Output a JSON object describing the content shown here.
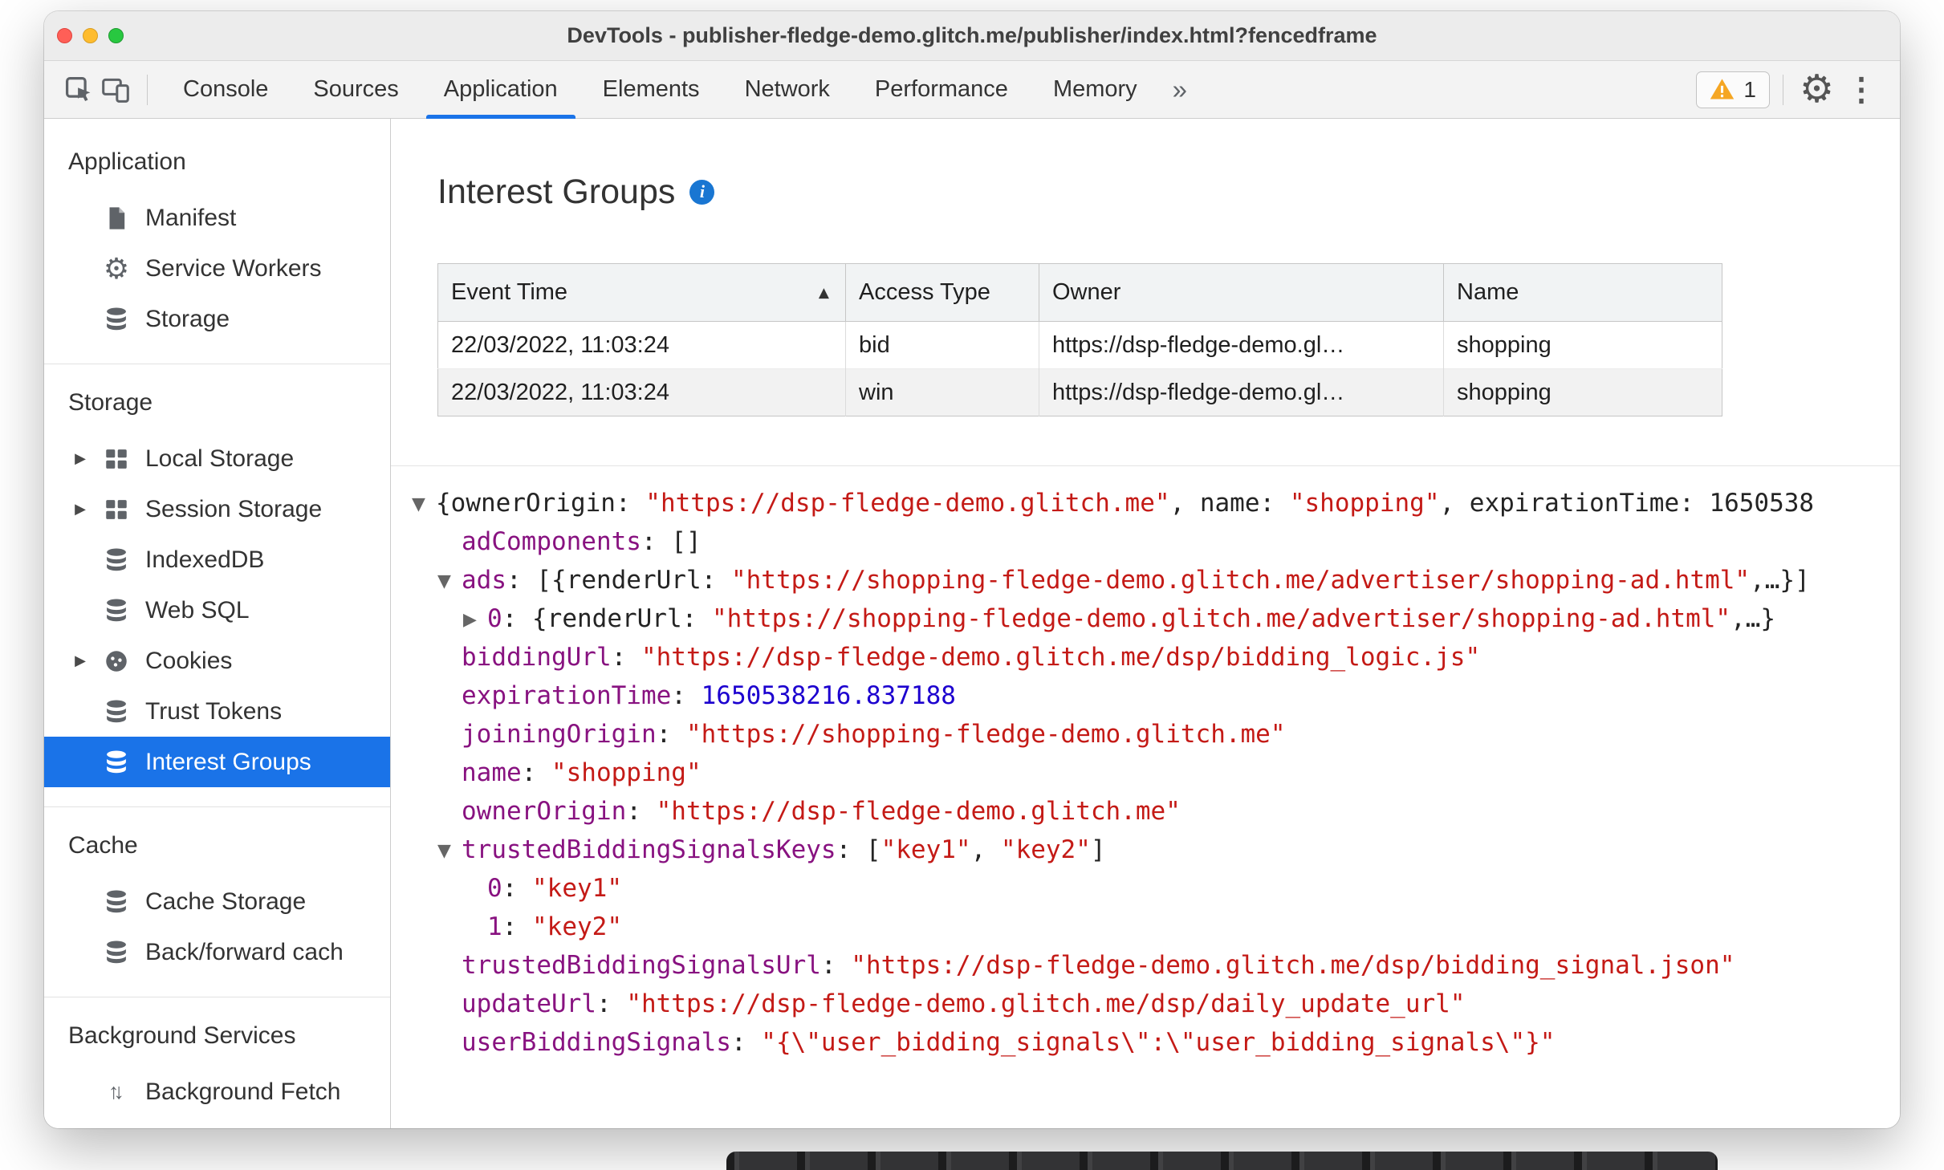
{
  "window": {
    "title": "DevTools - publisher-fledge-demo.glitch.me/publisher/index.html?fencedframe"
  },
  "toolbar": {
    "tabs": [
      {
        "label": "Console"
      },
      {
        "label": "Sources"
      },
      {
        "label": "Application",
        "selected": true
      },
      {
        "label": "Elements"
      },
      {
        "label": "Network"
      },
      {
        "label": "Performance"
      },
      {
        "label": "Memory"
      }
    ],
    "more_tabs": "»",
    "warning_count": "1"
  },
  "sidebar": {
    "sections": [
      {
        "title": "Application",
        "items": [
          {
            "label": "Manifest",
            "icon": "manifest-icon"
          },
          {
            "label": "Service Workers",
            "icon": "gear-icon"
          },
          {
            "label": "Storage",
            "icon": "database-icon"
          }
        ]
      },
      {
        "title": "Storage",
        "items": [
          {
            "label": "Local Storage",
            "icon": "table-icon",
            "expander": true
          },
          {
            "label": "Session Storage",
            "icon": "table-icon",
            "expander": true
          },
          {
            "label": "IndexedDB",
            "icon": "database-icon"
          },
          {
            "label": "Web SQL",
            "icon": "database-icon"
          },
          {
            "label": "Cookies",
            "icon": "cookie-icon",
            "expander": true
          },
          {
            "label": "Trust Tokens",
            "icon": "database-icon"
          },
          {
            "label": "Interest Groups",
            "icon": "database-icon",
            "selected": true
          }
        ]
      },
      {
        "title": "Cache",
        "items": [
          {
            "label": "Cache Storage",
            "icon": "database-icon"
          },
          {
            "label": "Back/forward cach",
            "icon": "database-icon"
          }
        ]
      },
      {
        "title": "Background Services",
        "items": [
          {
            "label": "Background Fetch",
            "icon": "background-fetch-icon"
          }
        ]
      }
    ]
  },
  "main": {
    "heading": "Interest Groups",
    "table": {
      "sort_glyph": "▲",
      "columns": [
        {
          "label": "Event Time",
          "sort": "asc"
        },
        {
          "label": "Access Type"
        },
        {
          "label": "Owner"
        },
        {
          "label": "Name"
        }
      ],
      "rows": [
        [
          "22/03/2022, 11:03:24",
          "bid",
          "https://dsp-fledge-demo.gl…",
          "shopping"
        ],
        [
          "22/03/2022, 11:03:24",
          "win",
          "https://dsp-fledge-demo.gl…",
          "shopping"
        ]
      ]
    },
    "tree": {
      "lines": [
        {
          "level": 0,
          "marker": "down",
          "segments": [
            {
              "c": "plain",
              "t": "{ownerOrigin: "
            },
            {
              "c": "string",
              "t": "\"https://dsp-fledge-demo.glitch.me\""
            },
            {
              "c": "plain",
              "t": ", name: "
            },
            {
              "c": "string",
              "t": "\"shopping\""
            },
            {
              "c": "plain",
              "t": ", expirationTime: "
            },
            {
              "c": "plain",
              "t": "1650538"
            }
          ]
        },
        {
          "level": 1,
          "marker": "none",
          "segments": [
            {
              "c": "key",
              "t": "adComponents"
            },
            {
              "c": "plain",
              "t": ": []"
            }
          ]
        },
        {
          "level": 1,
          "marker": "down",
          "segments": [
            {
              "c": "key",
              "t": "ads"
            },
            {
              "c": "plain",
              "t": ": [{renderUrl: "
            },
            {
              "c": "string",
              "t": "\"https://shopping-fledge-demo.glitch.me/advertiser/shopping-ad.html\""
            },
            {
              "c": "plain",
              "t": ",…}]"
            }
          ]
        },
        {
          "level": 2,
          "marker": "right",
          "segments": [
            {
              "c": "key",
              "t": "0"
            },
            {
              "c": "plain",
              "t": ": {renderUrl: "
            },
            {
              "c": "string",
              "t": "\"https://shopping-fledge-demo.glitch.me/advertiser/shopping-ad.html\""
            },
            {
              "c": "plain",
              "t": ",…}"
            }
          ]
        },
        {
          "level": 1,
          "marker": "none",
          "segments": [
            {
              "c": "key",
              "t": "biddingUrl"
            },
            {
              "c": "plain",
              "t": ": "
            },
            {
              "c": "string",
              "t": "\"https://dsp-fledge-demo.glitch.me/dsp/bidding_logic.js\""
            }
          ]
        },
        {
          "level": 1,
          "marker": "none",
          "segments": [
            {
              "c": "key",
              "t": "expirationTime"
            },
            {
              "c": "plain",
              "t": ": "
            },
            {
              "c": "number",
              "t": "1650538216.837188"
            }
          ]
        },
        {
          "level": 1,
          "marker": "none",
          "segments": [
            {
              "c": "key",
              "t": "joiningOrigin"
            },
            {
              "c": "plain",
              "t": ": "
            },
            {
              "c": "string",
              "t": "\"https://shopping-fledge-demo.glitch.me\""
            }
          ]
        },
        {
          "level": 1,
          "marker": "none",
          "segments": [
            {
              "c": "key",
              "t": "name"
            },
            {
              "c": "plain",
              "t": ": "
            },
            {
              "c": "string",
              "t": "\"shopping\""
            }
          ]
        },
        {
          "level": 1,
          "marker": "none",
          "segments": [
            {
              "c": "key",
              "t": "ownerOrigin"
            },
            {
              "c": "plain",
              "t": ": "
            },
            {
              "c": "string",
              "t": "\"https://dsp-fledge-demo.glitch.me\""
            }
          ]
        },
        {
          "level": 1,
          "marker": "down",
          "segments": [
            {
              "c": "key",
              "t": "trustedBiddingSignalsKeys"
            },
            {
              "c": "plain",
              "t": ": ["
            },
            {
              "c": "string",
              "t": "\"key1\""
            },
            {
              "c": "plain",
              "t": ", "
            },
            {
              "c": "string",
              "t": "\"key2\""
            },
            {
              "c": "plain",
              "t": "]"
            }
          ]
        },
        {
          "level": 2,
          "marker": "none",
          "segments": [
            {
              "c": "key",
              "t": "0"
            },
            {
              "c": "plain",
              "t": ": "
            },
            {
              "c": "string",
              "t": "\"key1\""
            }
          ]
        },
        {
          "level": 2,
          "marker": "none",
          "segments": [
            {
              "c": "key",
              "t": "1"
            },
            {
              "c": "plain",
              "t": ": "
            },
            {
              "c": "string",
              "t": "\"key2\""
            }
          ]
        },
        {
          "level": 1,
          "marker": "none",
          "segments": [
            {
              "c": "key",
              "t": "trustedBiddingSignalsUrl"
            },
            {
              "c": "plain",
              "t": ": "
            },
            {
              "c": "string",
              "t": "\"https://dsp-fledge-demo.glitch.me/dsp/bidding_signal.json\""
            }
          ]
        },
        {
          "level": 1,
          "marker": "none",
          "segments": [
            {
              "c": "key",
              "t": "updateUrl"
            },
            {
              "c": "plain",
              "t": ": "
            },
            {
              "c": "string",
              "t": "\"https://dsp-fledge-demo.glitch.me/dsp/daily_update_url\""
            }
          ]
        },
        {
          "level": 1,
          "marker": "none",
          "segments": [
            {
              "c": "key",
              "t": "userBiddingSignals"
            },
            {
              "c": "plain",
              "t": ": "
            },
            {
              "c": "string",
              "t": "\"{\\\"user_bidding_signals\\\":\\\"user_bidding_signals\\\"}\""
            }
          ]
        }
      ]
    }
  },
  "colors": {
    "accent": "#1a73e8",
    "key": "#881280",
    "string": "#c41a16",
    "number": "#1c00cf"
  }
}
